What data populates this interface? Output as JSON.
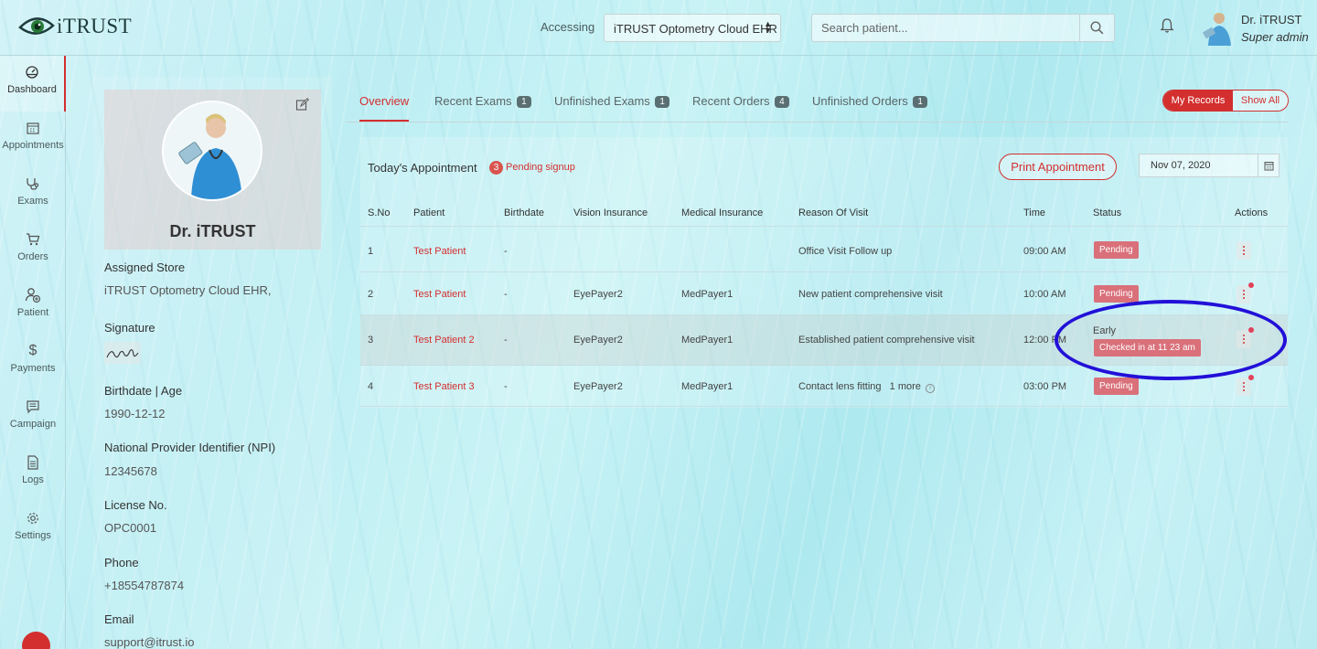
{
  "header": {
    "logo_text": "iTRUST",
    "accessing_label": "Accessing",
    "store_selected": "iTRUST Optometry Cloud EHR",
    "search_placeholder": "Search patient...",
    "user_name": "Dr. iTRUST",
    "user_role": "Super admin",
    "icons": [
      "search-icon",
      "bell-icon",
      "caret-updown-icon"
    ]
  },
  "sidebar": {
    "items": [
      {
        "label": "Dashboard",
        "icon": "dashboard-gauge-icon",
        "active": true
      },
      {
        "label": "Appointments",
        "icon": "calendar-icon"
      },
      {
        "label": "Exams",
        "icon": "stethoscope-icon"
      },
      {
        "label": "Orders",
        "icon": "cart-icon"
      },
      {
        "label": "Patient",
        "icon": "add-person-icon"
      },
      {
        "label": "Payments",
        "icon": "dollar-icon"
      },
      {
        "label": "Campaign",
        "icon": "chat-icon"
      },
      {
        "label": "Logs",
        "icon": "document-icon"
      },
      {
        "label": "Settings",
        "icon": "gear-icon"
      }
    ],
    "accent_color": "#d32f2f"
  },
  "profile": {
    "name": "Dr. iTRUST",
    "assigned_store_label": "Assigned Store",
    "assigned_store_value": "iTRUST Optometry Cloud EHR,",
    "signature_label": "Signature",
    "birthdate_label": "Birthdate | Age",
    "birthdate_value": "1990-12-12",
    "npi_label": "National Provider Identifier (NPI)",
    "npi_value": "12345678",
    "license_label": "License No.",
    "license_value": "OPC0001",
    "phone_label": "Phone",
    "phone_value": "+18554787874",
    "email_label": "Email",
    "email_value": "support@itrust.io"
  },
  "tabs": [
    {
      "label": "Overview",
      "badge": "",
      "active": true
    },
    {
      "label": "Recent Exams",
      "badge": "1"
    },
    {
      "label": "Unfinished Exams",
      "badge": "1"
    },
    {
      "label": "Recent Orders",
      "badge": "4"
    },
    {
      "label": "Unfinished Orders",
      "badge": "1"
    }
  ],
  "records_toggle": {
    "selected": "My Records",
    "other": "Show All"
  },
  "appointments": {
    "title": "Today's Appointment",
    "pending_count": "3",
    "pending_label": "Pending signup",
    "print_label": "Print Appointment",
    "date": "Nov 07, 2020",
    "columns": [
      "S.No",
      "Patient",
      "Birthdate",
      "Vision Insurance",
      "Medical Insurance",
      "Reason Of Visit",
      "Time",
      "Status",
      "Actions"
    ],
    "rows": [
      {
        "sno": "1",
        "patient": "Test Patient",
        "birthdate": "-",
        "vision": "",
        "medical": "",
        "reason": "Office Visit Follow up",
        "more": "",
        "time": "09:00 AM",
        "status_text": "",
        "status_badge": "Pending"
      },
      {
        "sno": "2",
        "patient": "Test Patient",
        "birthdate": "-",
        "vision": "EyePayer2",
        "medical": "MedPayer1",
        "reason": "New patient comprehensive visit",
        "more": "",
        "time": "10:00 AM",
        "status_text": "",
        "status_badge": "Pending"
      },
      {
        "sno": "3",
        "patient": "Test Patient 2",
        "birthdate": "-",
        "vision": "EyePayer2",
        "medical": "MedPayer1",
        "reason": "Established patient comprehensive visit",
        "more": "",
        "time": "12:00 PM",
        "status_text": "Early",
        "status_badge": "Checked in at 11 23 am"
      },
      {
        "sno": "4",
        "patient": "Test Patient 3",
        "birthdate": "-",
        "vision": "EyePayer2",
        "medical": "MedPayer1",
        "reason": "Contact lens fitting",
        "more": "1 more",
        "time": "03:00 PM",
        "status_text": "",
        "status_badge": "Pending"
      }
    ]
  },
  "colors": {
    "accent": "#d32f2f",
    "badge": "#d9707a",
    "annotation": "#2210d8"
  }
}
